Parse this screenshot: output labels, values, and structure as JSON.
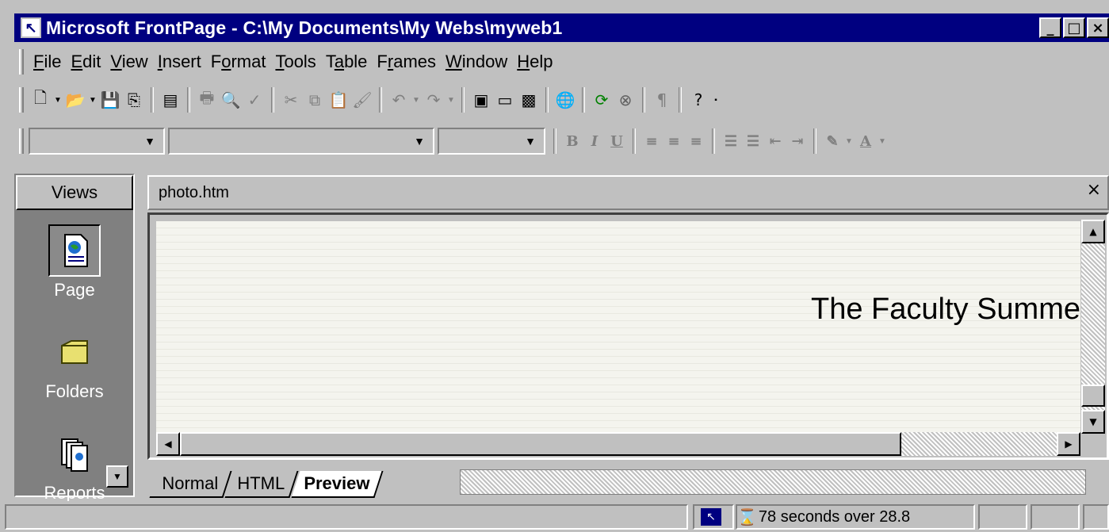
{
  "window": {
    "title": "Microsoft FrontPage - C:\\My Documents\\My Webs\\myweb1",
    "app_icon": "frontpage-icon",
    "controls": [
      "minimize",
      "maximize",
      "close"
    ]
  },
  "menu": [
    {
      "label": "File",
      "accel": "F",
      "rest": "ile"
    },
    {
      "label": "Edit",
      "accel": "E",
      "rest": "dit"
    },
    {
      "label": "View",
      "accel": "V",
      "rest": "iew"
    },
    {
      "label": "Insert",
      "accel": "I",
      "rest": "nsert"
    },
    {
      "label": "Format",
      "pre": "F",
      "accel": "o",
      "rest": "rmat"
    },
    {
      "label": "Tools",
      "accel": "T",
      "rest": "ools"
    },
    {
      "label": "Table",
      "pre": "T",
      "accel": "a",
      "rest": "ble"
    },
    {
      "label": "Frames",
      "pre": "F",
      "accel": "r",
      "rest": "ames"
    },
    {
      "label": "Window",
      "accel": "W",
      "rest": "indow"
    },
    {
      "label": "Help",
      "accel": "H",
      "rest": "elp"
    }
  ],
  "standard_toolbar": {
    "icons": [
      "new-page-icon",
      "open-icon",
      "save-icon",
      "publish-icon",
      "folder-list-icon",
      "print-icon",
      "print-preview-icon",
      "spelling-icon",
      "cut-icon",
      "copy-icon",
      "paste-icon",
      "format-painter-icon",
      "undo-icon",
      "redo-icon",
      "insert-component-icon",
      "insert-table-icon",
      "insert-picture-icon",
      "hyperlink-icon",
      "refresh-icon",
      "stop-icon",
      "show-all-icon",
      "help-icon"
    ]
  },
  "formatting_toolbar": {
    "style": "",
    "font": "",
    "size": "",
    "buttons": {
      "bold": "B",
      "italic": "I",
      "underline": "U"
    }
  },
  "views_bar": {
    "header": "Views",
    "items": [
      {
        "label": "Page",
        "icon": "page-view-icon",
        "selected": true
      },
      {
        "label": "Folders",
        "icon": "folder-icon",
        "selected": false
      },
      {
        "label": "Reports",
        "icon": "reports-icon",
        "selected": false
      }
    ]
  },
  "document": {
    "filename": "photo.htm",
    "content_text": "The Faculty Summe"
  },
  "view_tabs": [
    {
      "label": "Normal",
      "active": false
    },
    {
      "label": "HTML",
      "active": false
    },
    {
      "label": "Preview",
      "active": true
    }
  ],
  "status": {
    "download_time": "78 seconds over 28.8"
  }
}
